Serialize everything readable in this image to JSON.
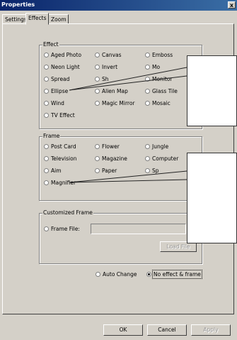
{
  "window": {
    "title": "Properties",
    "close_label": "x"
  },
  "tabs": [
    {
      "label": "Settings",
      "active": false
    },
    {
      "label": "Effects",
      "active": true
    },
    {
      "label": "Zoom",
      "active": false
    }
  ],
  "effect_group": {
    "title": "Effect",
    "options": [
      "Aged Photo",
      "Canvas",
      "Emboss",
      "Neon Light",
      "Invert",
      "Mo",
      "Spread",
      "Sh",
      "Monitor",
      "Ellipse",
      "Alien Map",
      "Glass Tile",
      "Wind",
      "Magic Mirror",
      "Mosaic",
      "TV Effect"
    ]
  },
  "frame_group": {
    "title": "Frame",
    "options": [
      "Post Card",
      "Flower",
      "Jungle",
      "Television",
      "Magazine",
      "Computer",
      "Aim",
      "Paper",
      "Sp",
      "Magnifier"
    ]
  },
  "custom_frame_group": {
    "title": "Customized Frame",
    "frame_file_label": "Frame File:",
    "frame_file_value": "",
    "load_file_label": "Load File"
  },
  "options": {
    "auto_change_label": "Auto Change",
    "no_effect_label": "No effect & frame",
    "selected": "No effect & frame"
  },
  "buttons": {
    "ok": "OK",
    "cancel": "Cancel",
    "apply": "Apply"
  }
}
